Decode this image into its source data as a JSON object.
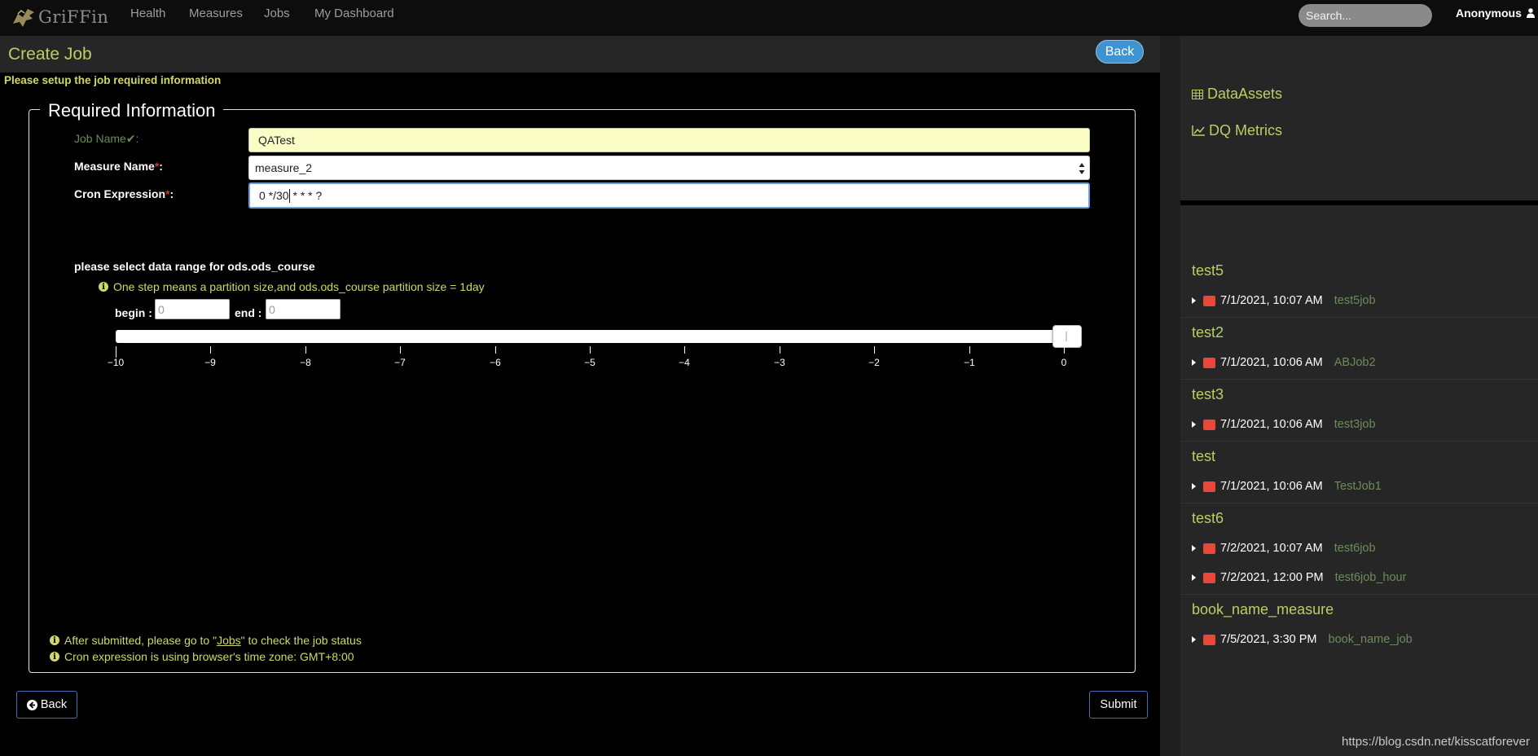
{
  "nav": {
    "brand": "GriFFin",
    "items": [
      "Health",
      "Measures",
      "Jobs",
      "My Dashboard"
    ],
    "search_placeholder": "Search...",
    "user": "Anonymous"
  },
  "page": {
    "title": "Create Job",
    "back_pill": "Back",
    "setup_message": "Please setup the job required information",
    "legend": "Required Information"
  },
  "form": {
    "job_name_label": "Job Name",
    "job_name_value": "QATest",
    "measure_label": "Measure Name",
    "measure_value": "measure_2",
    "cron_label": "Cron Expression",
    "cron_value_before_caret": "0 */30",
    "cron_value_after_caret": " * * * ?",
    "range_title": "please select data range for ods.ods_course",
    "step_note": "One step means a partition size,and ods.ods_course partition size = 1day",
    "begin_label": "begin :",
    "begin_placeholder": "0",
    "end_label": "end :",
    "end_placeholder": "0",
    "slider": {
      "ticks": [
        "−10",
        "−9",
        "−8",
        "−7",
        "−6",
        "−5",
        "−4",
        "−3",
        "−2",
        "−1",
        "0"
      ],
      "value": 0
    },
    "note1_before": "After submitted, please go to \"",
    "note1_link": "Jobs",
    "note1_after": "\" to check the job status",
    "note2": "Cron expression is using browser's time zone: GMT+8:00",
    "back_button": "Back",
    "submit_button": "Submit"
  },
  "sidebar": {
    "links": [
      "DataAssets",
      "DQ Metrics"
    ],
    "groups": [
      {
        "name": "test5",
        "rows": [
          {
            "time": "7/1/2021, 10:07 AM",
            "job": "test5job"
          }
        ]
      },
      {
        "name": "test2",
        "rows": [
          {
            "time": "7/1/2021, 10:06 AM",
            "job": "ABJob2"
          }
        ]
      },
      {
        "name": "test3",
        "rows": [
          {
            "time": "7/1/2021, 10:06 AM",
            "job": "test3job"
          }
        ]
      },
      {
        "name": "test",
        "rows": [
          {
            "time": "7/1/2021, 10:06 AM",
            "job": "TestJob1"
          }
        ]
      },
      {
        "name": "test6",
        "rows": [
          {
            "time": "7/2/2021, 10:07 AM",
            "job": "test6job"
          },
          {
            "time": "7/2/2021, 12:00 PM",
            "job": "test6job_hour"
          }
        ]
      },
      {
        "name": "book_name_measure",
        "rows": [
          {
            "time": "7/5/2021, 3:30 PM",
            "job": "book_name_job"
          }
        ]
      }
    ]
  },
  "watermark": "https://blog.csdn.net/kisscatforever",
  "colors": {
    "accent_green": "#b9cf66",
    "note_yellow": "#d1d868",
    "back_pill_blue": "#3f93d0",
    "chart_icon_red": "#e8473a",
    "required_star": "#e0302b"
  }
}
